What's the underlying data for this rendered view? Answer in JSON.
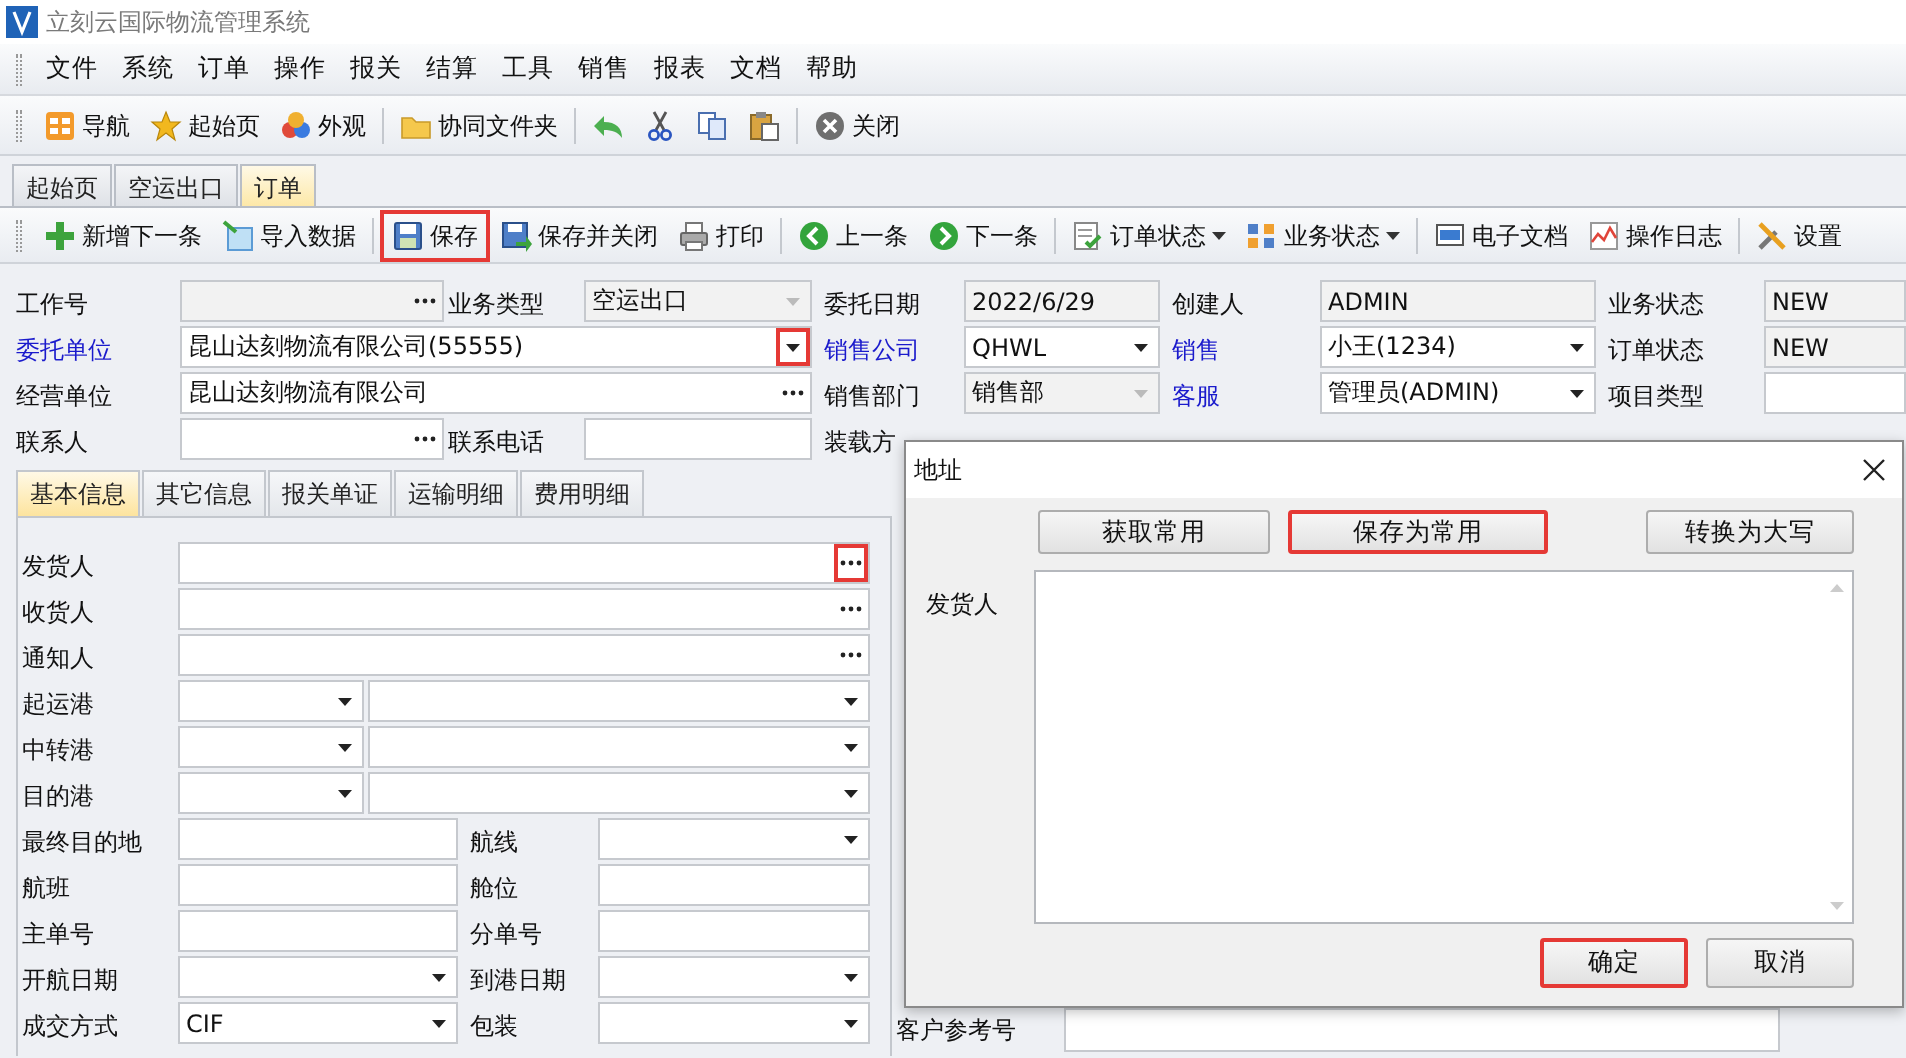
{
  "window": {
    "title": "立刻云国际物流管理系统"
  },
  "menu": [
    "文件",
    "系统",
    "订单",
    "操作",
    "报关",
    "结算",
    "工具",
    "销售",
    "报表",
    "文档",
    "帮助"
  ],
  "toolbar": [
    {
      "label": "导航"
    },
    {
      "label": "起始页"
    },
    {
      "label": "外观"
    },
    {
      "label": "协同文件夹"
    },
    {
      "label": "关闭"
    }
  ],
  "doc_tabs": [
    {
      "label": "起始页",
      "selected": false
    },
    {
      "label": "空运出口",
      "selected": false
    },
    {
      "label": "订单",
      "selected": true
    }
  ],
  "order_toolbar": [
    {
      "label": "新增下一条",
      "highlighted": false,
      "dropdown": false
    },
    {
      "label": "导入数据",
      "highlighted": false,
      "dropdown": false
    },
    {
      "label": "保存",
      "highlighted": true,
      "dropdown": false
    },
    {
      "label": "保存并关闭",
      "highlighted": false,
      "dropdown": false
    },
    {
      "label": "打印",
      "highlighted": false,
      "dropdown": false
    },
    {
      "label": "上一条",
      "highlighted": false,
      "dropdown": false
    },
    {
      "label": "下一条",
      "highlighted": false,
      "dropdown": false
    },
    {
      "label": "订单状态",
      "highlighted": false,
      "dropdown": true
    },
    {
      "label": "业务状态",
      "highlighted": false,
      "dropdown": true
    },
    {
      "label": "电子文档",
      "highlighted": false,
      "dropdown": false
    },
    {
      "label": "操作日志",
      "highlighted": false,
      "dropdown": false
    },
    {
      "label": "设置",
      "highlighted": false,
      "dropdown": false
    }
  ],
  "header_form": {
    "rows": [
      [
        {
          "kind": "label",
          "text": "工作号",
          "link": false
        },
        {
          "kind": "picker",
          "disabled": true,
          "highlighted": false
        },
        {
          "kind": "label",
          "text": "业务类型",
          "link": false
        },
        {
          "kind": "dropdown",
          "value": "空运出口",
          "disabled": true,
          "highlighted": false
        },
        {
          "kind": "label",
          "text": "委托日期",
          "link": false
        },
        {
          "kind": "textbox",
          "value": "2022/6/29",
          "disabled": true
        },
        {
          "kind": "label",
          "text": "创建人",
          "link": false
        },
        {
          "kind": "textbox",
          "value": "ADMIN",
          "disabled": true
        },
        {
          "kind": "label",
          "text": "业务状态",
          "link": false
        },
        {
          "kind": "textbox",
          "value": "NEW",
          "disabled": true
        }
      ],
      [
        {
          "kind": "label",
          "text": "委托单位",
          "link": true
        },
        {
          "kind": "dropdown",
          "value": "昆山达刻物流有限公司(55555)",
          "disabled": false,
          "highlighted": true
        },
        null,
        null,
        {
          "kind": "label",
          "text": "销售公司",
          "link": true
        },
        {
          "kind": "dropdown",
          "value": "QHWL",
          "disabled": false,
          "highlighted": false
        },
        {
          "kind": "label",
          "text": "销售",
          "link": true
        },
        {
          "kind": "dropdown",
          "value": "小王(1234)",
          "disabled": false,
          "highlighted": false
        },
        {
          "kind": "label",
          "text": "订单状态",
          "link": false
        },
        {
          "kind": "textbox",
          "value": "NEW",
          "disabled": true
        }
      ],
      [
        {
          "kind": "label",
          "text": "经营单位",
          "link": false
        },
        {
          "kind": "picker",
          "value": "昆山达刻物流有限公司",
          "disabled": false,
          "highlighted": false
        },
        null,
        null,
        {
          "kind": "label",
          "text": "销售部门",
          "link": false
        },
        {
          "kind": "dropdown",
          "value": "销售部",
          "disabled": true,
          "highlighted": false
        },
        {
          "kind": "label",
          "text": "客服",
          "link": true
        },
        {
          "kind": "dropdown",
          "value": "管理员(ADMIN)",
          "disabled": false,
          "highlighted": false
        },
        {
          "kind": "label",
          "text": "项目类型",
          "link": false
        },
        {
          "kind": "textbox",
          "disabled": false
        }
      ],
      [
        {
          "kind": "label",
          "text": "联系人",
          "link": false
        },
        {
          "kind": "picker",
          "disabled": false,
          "highlighted": false
        },
        {
          "kind": "label",
          "text": "联系电话",
          "link": false
        },
        {
          "kind": "textbox",
          "disabled": false
        },
        {
          "kind": "label",
          "text": "装载方",
          "link": false
        }
      ]
    ]
  },
  "sub_tabs": [
    {
      "label": "基本信息",
      "selected": true
    },
    {
      "label": "其它信息",
      "selected": false
    },
    {
      "label": "报关单证",
      "selected": false
    },
    {
      "label": "运输明细",
      "selected": false
    },
    {
      "label": "费用明细",
      "selected": false
    }
  ],
  "basic_info": {
    "rows": [
      [
        {
          "kind": "label",
          "text": "发货人"
        },
        {
          "kind": "picker",
          "highlighted": true
        }
      ],
      [
        {
          "kind": "label",
          "text": "收货人"
        },
        {
          "kind": "picker",
          "highlighted": false
        }
      ],
      [
        {
          "kind": "label",
          "text": "通知人"
        },
        {
          "kind": "picker",
          "highlighted": false
        }
      ],
      [
        {
          "kind": "label",
          "text": "起运港"
        },
        {
          "kind": "dropdown",
          "highlighted": false
        },
        {
          "kind": "dropdown",
          "highlighted": false
        }
      ],
      [
        {
          "kind": "label",
          "text": "中转港"
        },
        {
          "kind": "dropdown",
          "highlighted": false
        },
        {
          "kind": "dropdown",
          "highlighted": false
        }
      ],
      [
        {
          "kind": "label",
          "text": "目的港"
        },
        {
          "kind": "dropdown",
          "highlighted": false
        },
        {
          "kind": "dropdown",
          "highlighted": false
        }
      ],
      [
        {
          "kind": "label",
          "text": "最终目的地"
        },
        {
          "kind": "textbox"
        },
        {
          "kind": "label",
          "text": "航线"
        },
        {
          "kind": "dropdown",
          "highlighted": false
        }
      ],
      [
        {
          "kind": "label",
          "text": "航班"
        },
        {
          "kind": "textbox"
        },
        {
          "kind": "label",
          "text": "舱位"
        },
        {
          "kind": "textbox"
        }
      ],
      [
        {
          "kind": "label",
          "text": "主单号"
        },
        {
          "kind": "textbox"
        },
        {
          "kind": "label",
          "text": "分单号"
        },
        {
          "kind": "textbox"
        }
      ],
      [
        {
          "kind": "label",
          "text": "开航日期"
        },
        {
          "kind": "dropdown",
          "highlighted": false
        },
        {
          "kind": "label",
          "text": "到港日期"
        },
        {
          "kind": "dropdown",
          "highlighted": false
        }
      ],
      [
        {
          "kind": "label",
          "text": "成交方式"
        },
        {
          "kind": "dropdown",
          "value": "CIF",
          "highlighted": false
        },
        {
          "kind": "label",
          "text": "包装"
        },
        {
          "kind": "dropdown",
          "highlighted": false
        }
      ]
    ]
  },
  "customer_ref": {
    "label": "客户参考号"
  },
  "dialog": {
    "title": "地址",
    "buttons": [
      {
        "label": "获取常用",
        "highlighted": false
      },
      {
        "label": "保存为常用",
        "highlighted": true
      },
      {
        "label": "转换为大写",
        "highlighted": false
      }
    ],
    "field_label": "发货人",
    "actions": [
      {
        "label": "确定",
        "highlighted": true
      },
      {
        "label": "取消",
        "highlighted": false
      }
    ]
  }
}
